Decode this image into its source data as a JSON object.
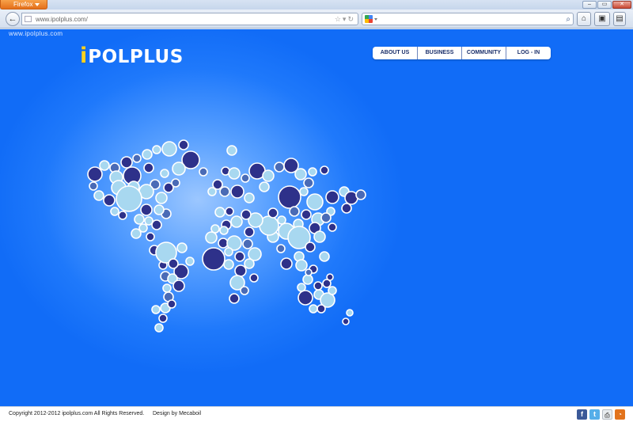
{
  "browser": {
    "firefox_label": "Firefox",
    "url": "www.ipolplus.com/",
    "win_buttons": [
      "–",
      "▭",
      "✕"
    ],
    "nav_icons": [
      "back-arrow-icon",
      "home-icon",
      "bookmarks-icon",
      "addon-icon"
    ]
  },
  "page": {
    "url_caption": "www.ipolplus.com",
    "logo_i": "i",
    "logo_rest": "POLPLUS",
    "nav": [
      "ABOUT US",
      "BUSINESS",
      "COMMUNITY",
      "LOG - IN"
    ]
  },
  "footer": {
    "copyright": "Copyright 2012-2012 ipolplus.com All Rights Reserved.",
    "design_by": "Design by Mecaboil",
    "social_icons": [
      "facebook-icon",
      "twitter-icon",
      "print-icon",
      "rss-icon"
    ],
    "social_glyphs": [
      "f",
      "t",
      "⎙",
      "◔"
    ]
  },
  "colors": {
    "page_blue": "#116cf7",
    "logo_yellow": "#ffd21f",
    "bubble_dark": "#2e318a",
    "bubble_light": "#a8d8f0",
    "bubble_mid": "#4a6bb6"
  }
}
